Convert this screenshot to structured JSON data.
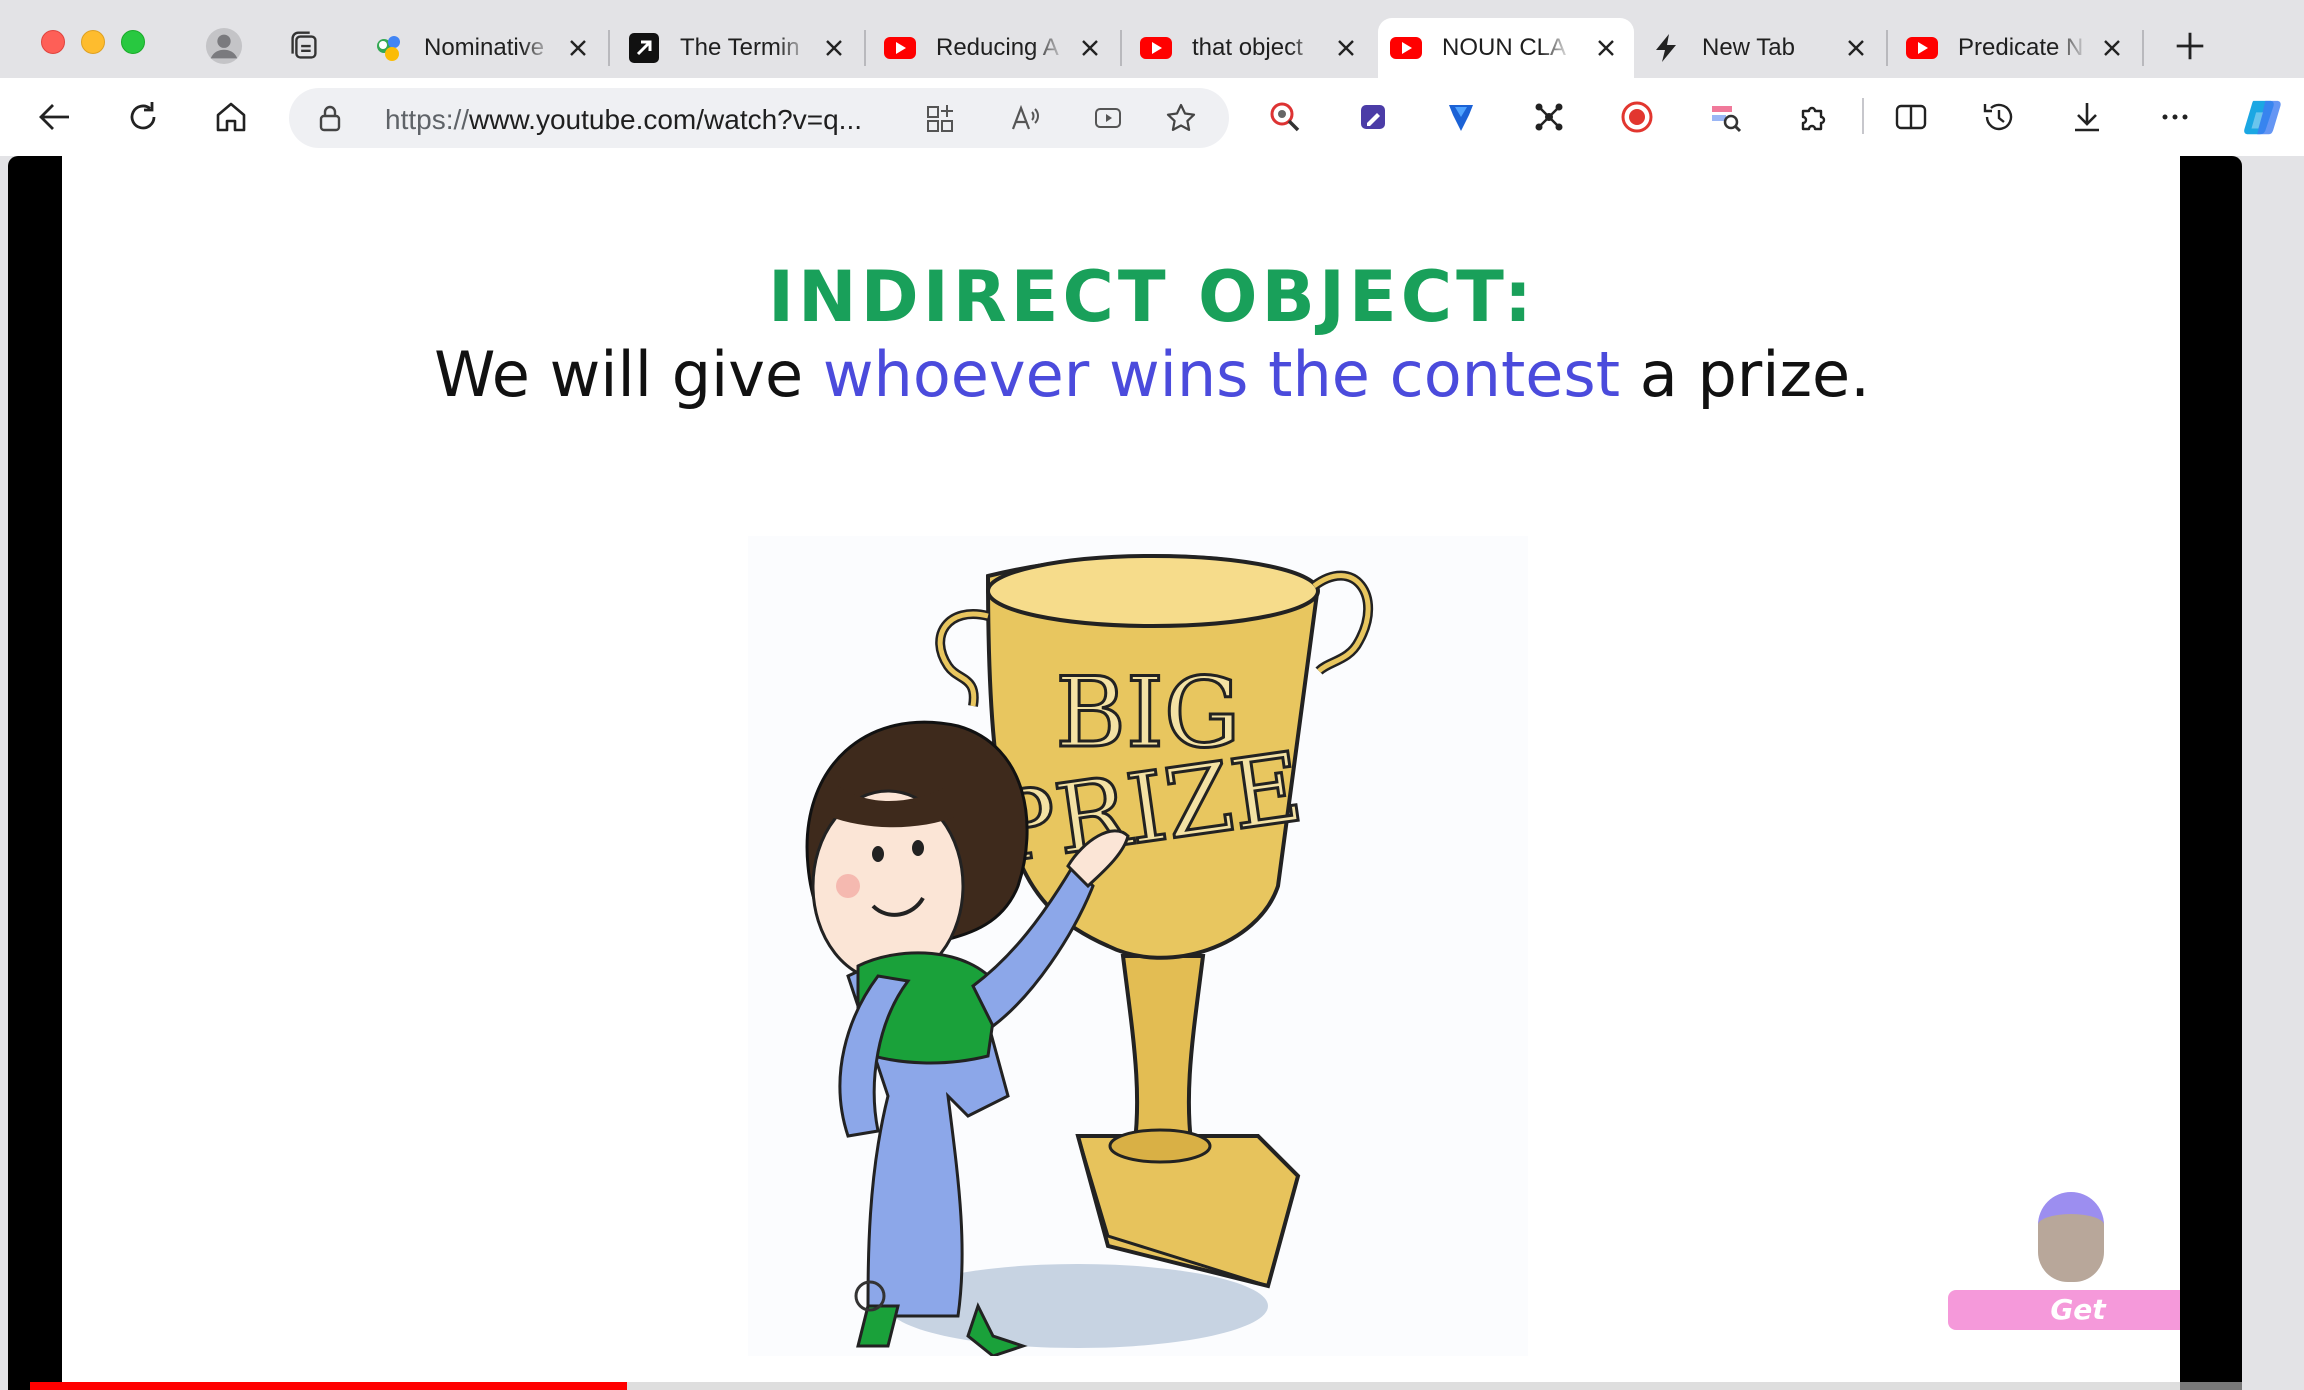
{
  "browser": {
    "tabs": [
      {
        "title": "Nominative",
        "favicon": "google-groups-icon",
        "active": false
      },
      {
        "title": "The Termin",
        "favicon": "arrow-up-right-icon",
        "active": false
      },
      {
        "title": "Reducing A",
        "favicon": "youtube-icon",
        "active": false
      },
      {
        "title": "that object",
        "favicon": "youtube-icon",
        "active": false
      },
      {
        "title": "NOUN CLA",
        "favicon": "youtube-icon",
        "active": true
      },
      {
        "title": "New Tab",
        "favicon": "lightning-icon",
        "active": false
      },
      {
        "title": "Predicate N",
        "favicon": "youtube-icon",
        "active": false
      }
    ],
    "address_bar": {
      "url_prefix": "https://",
      "url_rest": "www.youtube.com/watch?v=q..."
    },
    "colors": {
      "youtube_red": "#ff0000",
      "active_tab_bg": "#ffffff",
      "tabstrip_bg": "#e3e3e6"
    }
  },
  "video": {
    "slide": {
      "heading": "INDIRECT OBJECT:",
      "sentence_before": "We will give ",
      "sentence_highlight": "whoever wins the contest",
      "sentence_after": " a prize.",
      "trophy_text_line1": "BIG",
      "trophy_text_line2": "PRIZE"
    },
    "watermark_text": "Get Grammarous",
    "progress": 0.27,
    "colors": {
      "heading": "#19a05a",
      "highlight": "#4b4bdc",
      "progress": "#ff0000",
      "watermark": "#f58fd7"
    }
  }
}
